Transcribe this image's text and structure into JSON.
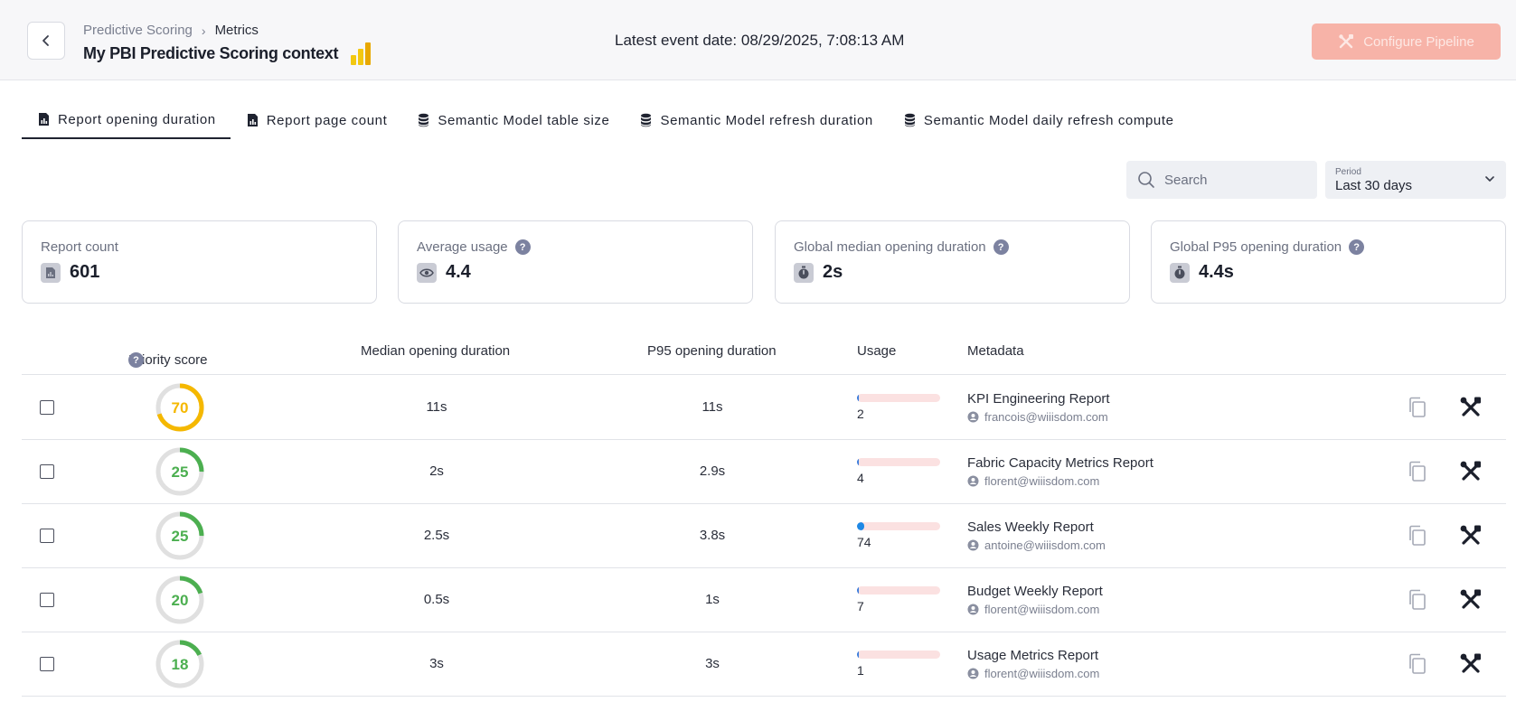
{
  "header": {
    "breadcrumb": [
      "Predictive Scoring",
      "Metrics"
    ],
    "context_title": "My PBI Predictive Scoring context",
    "latest_event": "Latest event date: 08/29/2025, 7:08:13 AM",
    "configure_label": "Configure Pipeline"
  },
  "tabs": [
    {
      "label": "Report opening duration",
      "icon": "report-icon",
      "active": true
    },
    {
      "label": "Report page count",
      "icon": "report-icon",
      "active": false
    },
    {
      "label": "Semantic Model table size",
      "icon": "database-icon",
      "active": false
    },
    {
      "label": "Semantic Model refresh duration",
      "icon": "database-icon",
      "active": false
    },
    {
      "label": "Semantic Model daily refresh compute",
      "icon": "database-icon",
      "active": false
    }
  ],
  "filters": {
    "search_placeholder": "Search",
    "period_label": "Period",
    "period_value": "Last 30 days"
  },
  "cards": [
    {
      "label": "Report count",
      "value": "601",
      "icon": "report-icon",
      "help": false
    },
    {
      "label": "Average usage",
      "value": "4.4",
      "icon": "eye-icon",
      "help": true
    },
    {
      "label": "Global median opening duration",
      "value": "2s",
      "icon": "stopwatch-icon",
      "help": true
    },
    {
      "label": "Global P95 opening duration",
      "value": "4.4s",
      "icon": "stopwatch-icon",
      "help": true
    }
  ],
  "table": {
    "columns": [
      "Priority score",
      "Median opening duration",
      "P95 opening duration",
      "Usage",
      "Metadata"
    ],
    "rows": [
      {
        "score": "70",
        "score_fraction": 0.7,
        "score_color": "#f5b800",
        "median": "11s",
        "p95": "11s",
        "usage": "2",
        "usage_fraction": 0.01,
        "usage_color": "#3b7ddd",
        "name": "KPI Engineering Report",
        "owner": "francois@wiiisdom.com"
      },
      {
        "score": "25",
        "score_fraction": 0.25,
        "score_color": "#4caf50",
        "median": "2s",
        "p95": "2.9s",
        "usage": "4",
        "usage_fraction": 0.02,
        "usage_color": "#3b7ddd",
        "name": "Fabric Capacity Metrics Report",
        "owner": "florent@wiiisdom.com"
      },
      {
        "score": "25",
        "score_fraction": 0.25,
        "score_color": "#4caf50",
        "median": "2.5s",
        "p95": "3.8s",
        "usage": "74",
        "usage_fraction": 0.09,
        "usage_color": "#1e88e5",
        "name": "Sales Weekly Report",
        "owner": "antoine@wiiisdom.com"
      },
      {
        "score": "20",
        "score_fraction": 0.2,
        "score_color": "#4caf50",
        "median": "0.5s",
        "p95": "1s",
        "usage": "7",
        "usage_fraction": 0.02,
        "usage_color": "#3b7ddd",
        "name": "Budget Weekly Report",
        "owner": "florent@wiiisdom.com"
      },
      {
        "score": "18",
        "score_fraction": 0.18,
        "score_color": "#4caf50",
        "median": "3s",
        "p95": "3s",
        "usage": "1",
        "usage_fraction": 0.01,
        "usage_color": "#3b7ddd",
        "name": "Usage Metrics Report",
        "owner": "florent@wiiisdom.com"
      }
    ]
  },
  "colors": {
    "accent": "#f7b3a8",
    "ring_track": "#e0e0e0",
    "usage_track": "#fbe1e1"
  }
}
